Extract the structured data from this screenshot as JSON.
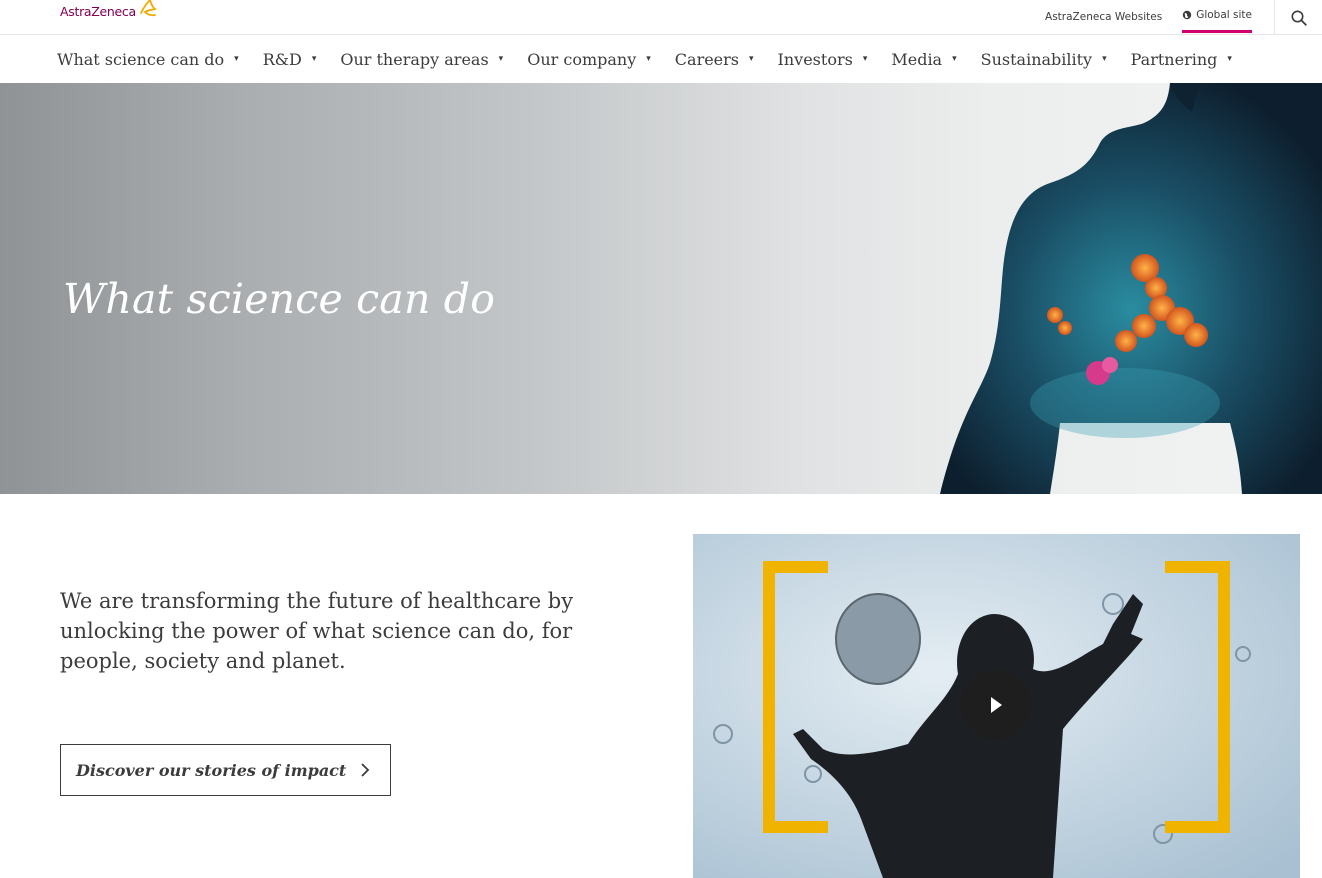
{
  "brand": {
    "logo_text": "AstraZeneca",
    "accent_color": "#830051",
    "highlight_color": "#d0006f",
    "logo_mark_color": "#f0ab00"
  },
  "topbar": {
    "websites_label": "AstraZeneca Websites",
    "global_site_label": "Global site",
    "search_icon": "search-icon",
    "globe_icon": "globe-icon"
  },
  "nav": {
    "items": [
      {
        "label": "What science can do"
      },
      {
        "label": "R&D"
      },
      {
        "label": "Our therapy areas"
      },
      {
        "label": "Our company"
      },
      {
        "label": "Careers"
      },
      {
        "label": "Investors"
      },
      {
        "label": "Media"
      },
      {
        "label": "Sustainability"
      },
      {
        "label": "Partnering"
      }
    ],
    "caret_glyph": "▾"
  },
  "hero": {
    "title": "What science can do"
  },
  "content": {
    "intro": "We are transforming the future of healthcare by unlocking the power of what science can do, for people, society and planet.",
    "cta_label": "Discover our stories of impact",
    "bracket_color": "#f0b400"
  }
}
